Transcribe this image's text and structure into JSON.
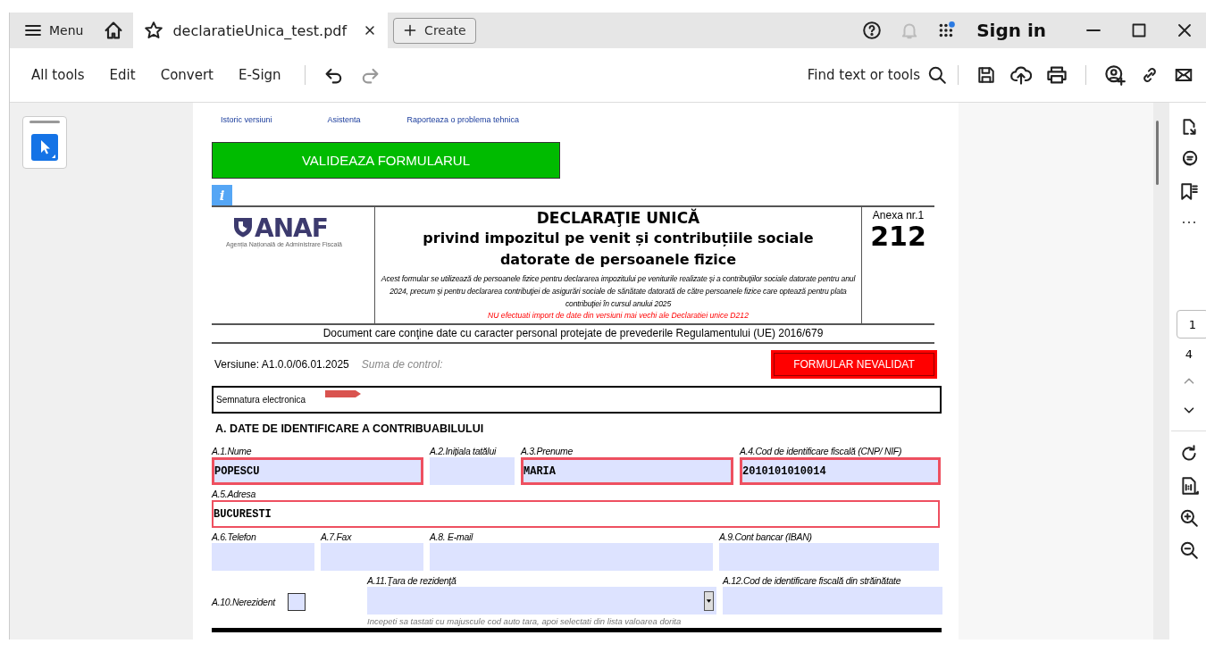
{
  "title_bar": {
    "menu": "Menu",
    "tab": {
      "title": "declaratieUnica_test.pdf",
      "selected": true
    },
    "create": "Create",
    "sign_in": "Sign in"
  },
  "toolbar": {
    "items": [
      "All tools",
      "Edit",
      "Convert",
      "E-Sign"
    ],
    "search": "Find text or tools"
  },
  "page_nav": {
    "current": "1",
    "total": "4"
  },
  "document": {
    "links": [
      "Istoric versiuni",
      "Asistenta",
      "Raporteaza o problema tehnica"
    ],
    "validate_button": "VALIDEAZA FORMULARUL",
    "info": "i",
    "logo": {
      "name": "ANAF",
      "subtitle": "Agenția Națională de Administrare Fiscală"
    },
    "title": "DECLARAŢIE UNICĂ",
    "subtitle_lines": [
      "privind impozitul pe venit și contribuțiile sociale",
      "datorate de persoanele fizice"
    ],
    "description": "Acest formular se utilizează de persoanele fizice pentru declararea impozitului pe veniturile realizate și a contribuţiilor sociale datorate pentru anul 2024, precum și pentru declararea contribuţiei de asigurări sociale de sănătate datorată de către persoanele fizice care optează pentru plata contribuţiei în cursul anului 2025",
    "warning": "NU efectuati import de date din versiuni mai vechi ale Declaratiei unice D212",
    "annex_label": "Anexa nr.1",
    "annex_number": "212",
    "privacy": "Document care conţine date cu caracter personal protejate de prevederile Regulamentului (UE) 2016/679",
    "version": "Versiune:  A1.0.0/06.01.2025",
    "checksum_label": "Suma de control:",
    "status": "FORMULAR NEVALIDAT",
    "signature_label": "Semnatura electronica",
    "section_title": "A. DATE DE IDENTIFICARE A CONTRIBUABILULUI",
    "field_rows": [
      [
        {
          "kind": "text",
          "label": "A.1.Nume",
          "value": "POPESCU",
          "invalid": true
        },
        {
          "kind": "text",
          "label": "A.2.Inițiala tatălui",
          "invalid": false
        },
        {
          "kind": "text",
          "label": "A.3.Prenume",
          "value": "MARIA",
          "invalid": true
        },
        {
          "kind": "text",
          "label": "A.4.Cod de identificare fiscală (CNP/ NIF)",
          "value": "2010101010014",
          "invalid": true
        }
      ],
      [
        {
          "kind": "text",
          "label": "A.5.Adresa",
          "value": "BUCURESTI",
          "invalid": true
        }
      ],
      [
        {
          "kind": "text",
          "label": "A.6.Telefon",
          "invalid": false
        },
        {
          "kind": "text",
          "label": "A.7.Fax",
          "invalid": false
        },
        {
          "kind": "text",
          "label": "A.8. E-mail",
          "invalid": false
        },
        {
          "kind": "text",
          "label": "A.9.Cont bancar (IBAN)",
          "invalid": false
        }
      ],
      [
        {
          "kind": "checkbox",
          "label": "A.10.Nerezident",
          "checked": false
        },
        {
          "kind": "dropdown",
          "label": "A.11.Ţara de rezidenţă",
          "hint": "Incepeti sa tastati cu majuscule cod auto tara, apoi selectati din lista valoarea dorita",
          "invalid": false
        },
        {
          "kind": "text",
          "label": "A.12.Cod de identificare fiscală din străinătate",
          "invalid": false
        }
      ]
    ]
  }
}
